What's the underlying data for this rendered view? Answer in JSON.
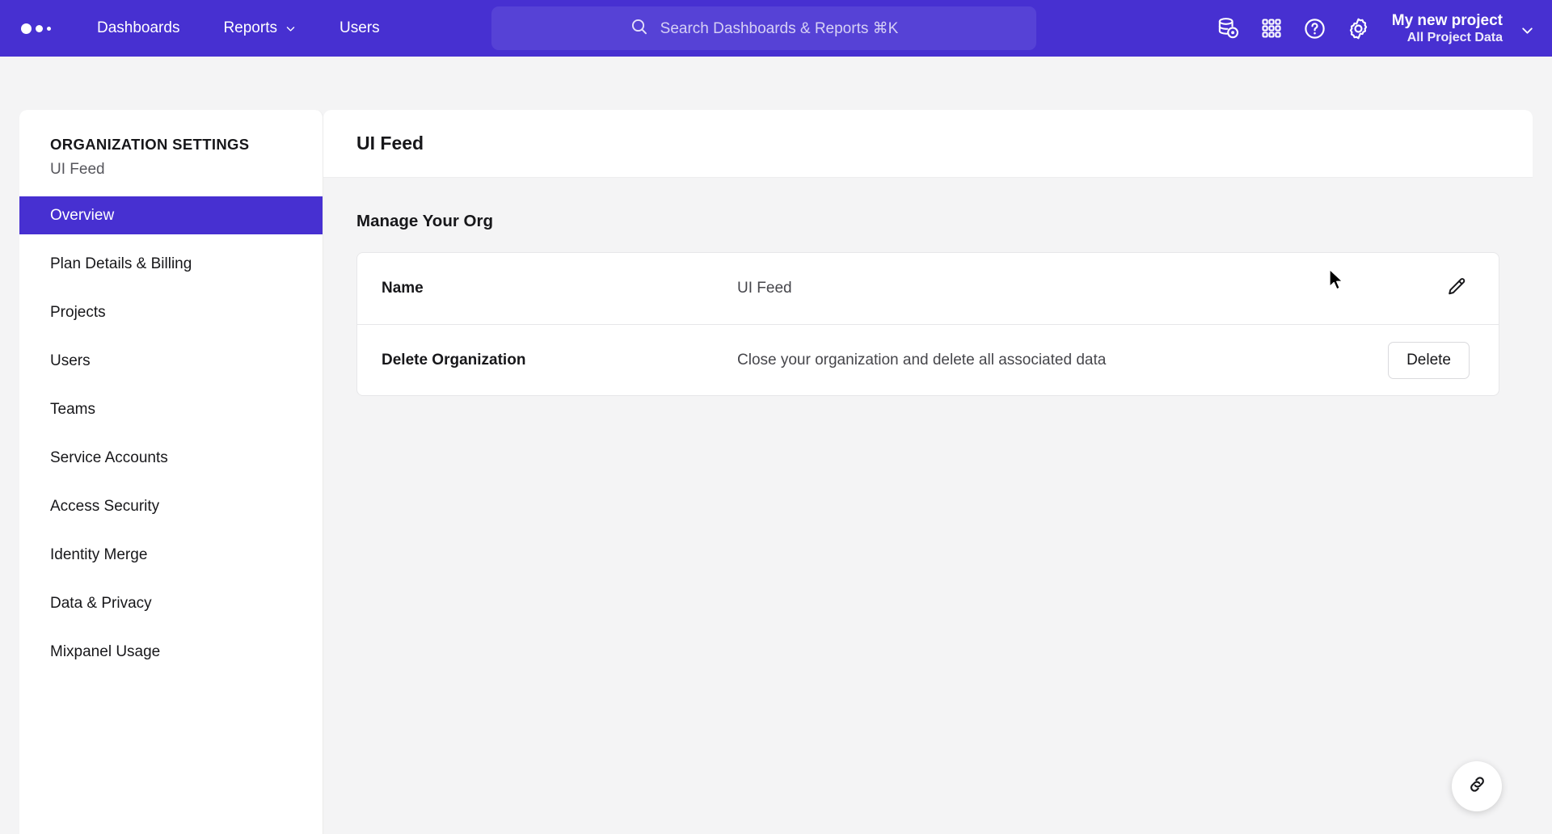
{
  "header": {
    "logo_name": "mixpanel-logo",
    "nav": [
      {
        "label": "Dashboards",
        "has_chevron": false
      },
      {
        "label": "Reports",
        "has_chevron": true
      },
      {
        "label": "Users",
        "has_chevron": false
      }
    ],
    "search": {
      "placeholder": "Search Dashboards & Reports ⌘K",
      "icon": "search-icon"
    },
    "icons": [
      {
        "name": "data-management-icon"
      },
      {
        "name": "apps-grid-icon"
      },
      {
        "name": "help-circle-icon"
      },
      {
        "name": "settings-gear-icon"
      }
    ],
    "project": {
      "name": "My new project",
      "subtitle": "All Project Data",
      "chevron": "chevron-down-icon"
    },
    "brand_color": "#4730D1",
    "search_bg": "#5642D6"
  },
  "sidebar": {
    "title": "ORGANIZATION SETTINGS",
    "subtitle": "UI Feed",
    "items": [
      {
        "label": "Overview",
        "active": true
      },
      {
        "label": "Plan Details & Billing",
        "active": false
      },
      {
        "label": "Projects",
        "active": false
      },
      {
        "label": "Users",
        "active": false
      },
      {
        "label": "Teams",
        "active": false
      },
      {
        "label": "Service Accounts",
        "active": false
      },
      {
        "label": "Access Security",
        "active": false
      },
      {
        "label": "Identity Merge",
        "active": false
      },
      {
        "label": "Data & Privacy",
        "active": false
      },
      {
        "label": "Mixpanel Usage",
        "active": false
      }
    ],
    "active_color": "#4730D1"
  },
  "main": {
    "page_title": "UI Feed",
    "section_title": "Manage Your Org",
    "rows": [
      {
        "label": "Name",
        "value": "UI Feed",
        "action_type": "icon",
        "action_icon": "pencil-edit-icon",
        "action_label": ""
      },
      {
        "label": "Delete Organization",
        "value": "Close your organization and delete all associated data",
        "action_type": "button",
        "action_icon": "",
        "action_label": "Delete"
      }
    ]
  },
  "fab": {
    "icon": "link-chain-icon"
  }
}
